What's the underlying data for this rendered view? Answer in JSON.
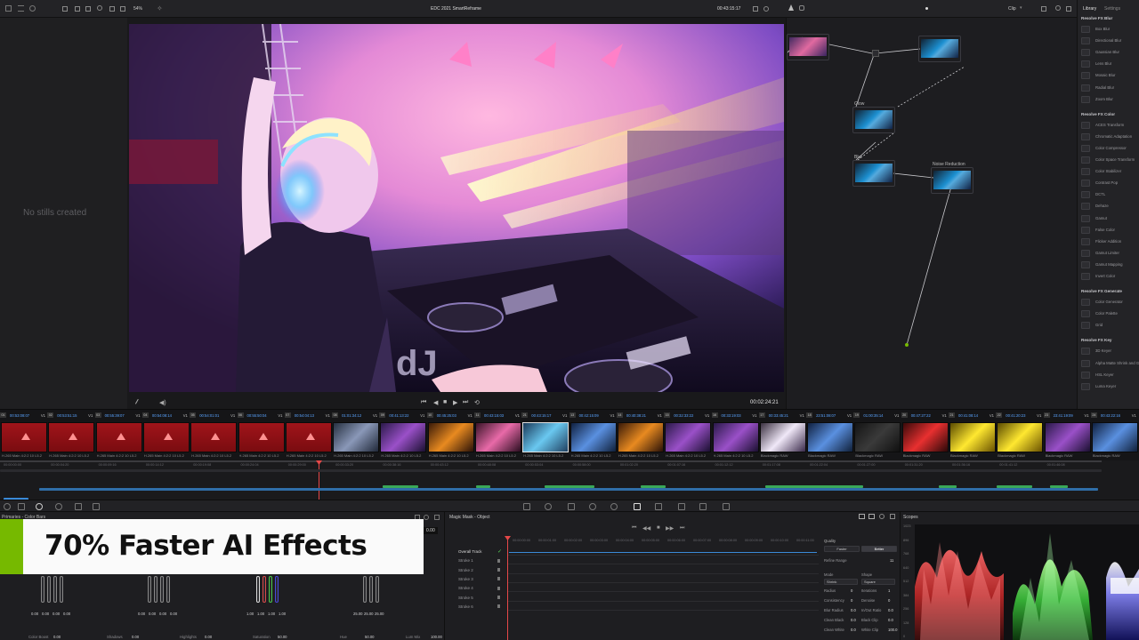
{
  "topbar": {
    "project_title": "EDC 2021 SmartReframe",
    "zoom": "54%",
    "timecode": "00:43:15:17",
    "clip_mode": "Clip",
    "tab_library": "Library",
    "tab_settings": "Settings"
  },
  "gallery": {
    "empty_text": "No stills created"
  },
  "viewer": {
    "timecode": "00:02:24:21"
  },
  "library": {
    "sections": [
      {
        "title": "Resolve FX Blur",
        "items": [
          "Box Blur",
          "Directional Blur",
          "Gaussian Blur",
          "Lens Blur",
          "Mosaic Blur",
          "Radial Blur",
          "Zoom Blur"
        ]
      },
      {
        "title": "Resolve FX Color",
        "items": [
          "ACES Transform",
          "Chromatic Adaptation",
          "Color Compressor",
          "Color Space Transform",
          "Color Stabilizer",
          "Contrast Pop",
          "DCTL",
          "Dehaze",
          "Gamut",
          "False Color",
          "Flicker Addition",
          "Gamut Limiter",
          "Gamut Mapping",
          "Invert Color"
        ]
      },
      {
        "title": "Resolve FX Generate",
        "items": [
          "Color Generator",
          "Color Palette",
          "Grid"
        ]
      },
      {
        "title": "Resolve FX Key",
        "items": [
          "3D Keyer",
          "Alpha Matte Shrink and Grow",
          "HSL Keyer",
          "Luma Keyer"
        ]
      }
    ]
  },
  "nodes": {
    "labels": [
      "Glow",
      "Blur",
      "Noise Reduction"
    ]
  },
  "clips": {
    "items": [
      {
        "num": "01",
        "tc": "00:53:08:07",
        "v": "V1",
        "label": "H.265 Main 4:2:2 10 L5.2",
        "kind": "red"
      },
      {
        "num": "02",
        "tc": "00:53:51:15",
        "v": "V1",
        "label": "H.265 Main 4:2:2 10 L5.2",
        "kind": "red"
      },
      {
        "num": "03",
        "tc": "00:55:39:07",
        "v": "V1",
        "label": "H.265 Main 4:2:2 10 L5.2",
        "kind": "red"
      },
      {
        "num": "04",
        "tc": "00:54:08:14",
        "v": "V1",
        "label": "H.265 Main 4:2:2 10 L5.2",
        "kind": "red"
      },
      {
        "num": "05",
        "tc": "00:54:01:01",
        "v": "V1",
        "label": "H.265 Main 4:2:2 10 L5.2",
        "kind": "red"
      },
      {
        "num": "06",
        "tc": "00:55:50:04",
        "v": "V1",
        "label": "H.265 Main 4:2:2 10 L5.2",
        "kind": "red"
      },
      {
        "num": "07",
        "tc": "00:54:04:13",
        "v": "V1",
        "label": "H.265 Main 4:2:2 10 L5.2",
        "kind": "red"
      },
      {
        "num": "08",
        "tc": "01:01:34:12",
        "v": "V1",
        "label": "H.265 Main 4:2:2 10 L5.2",
        "kind": "crowd"
      },
      {
        "num": "09",
        "tc": "00:41:13:22",
        "v": "V1",
        "label": "H.265 Main 4:2:2 10 L5.2",
        "kind": "purple"
      },
      {
        "num": "10",
        "tc": "00:45:25:03",
        "v": "V1",
        "label": "H.265 Main 4:2:2 10 L5.2",
        "kind": "orange"
      },
      {
        "num": "11",
        "tc": "00:43:15:03",
        "v": "V1",
        "label": "H.265 Main 4:2:2 10 L5.2",
        "kind": "pink"
      },
      {
        "num": "21",
        "tc": "00:43:15:17",
        "v": "V1",
        "label": "H.265 Main 4:2:2 10 L5.2",
        "kind": "active"
      },
      {
        "num": "13",
        "tc": "00:42:15:09",
        "v": "V1",
        "label": "H.265 Main 4:2:2 10 L5.2",
        "kind": "stage"
      },
      {
        "num": "14",
        "tc": "00:40:38:21",
        "v": "V1",
        "label": "H.265 Main 4:2:2 10 L5.2",
        "kind": "orange"
      },
      {
        "num": "15",
        "tc": "00:32:33:22",
        "v": "V1",
        "label": "H.265 Main 4:2:2 10 L5.2",
        "kind": "purple"
      },
      {
        "num": "16",
        "tc": "00:33:19:03",
        "v": "V1",
        "label": "H.265 Main 4:2:2 10 L5.2",
        "kind": "purple"
      },
      {
        "num": "17",
        "tc": "00:33:45:21",
        "v": "V1",
        "label": "Blackmagic RAW",
        "kind": "white"
      },
      {
        "num": "18",
        "tc": "23:51:08:07",
        "v": "V1",
        "label": "Blackmagic RAW",
        "kind": "stage"
      },
      {
        "num": "19",
        "tc": "01:00:35:14",
        "v": "V1",
        "label": "Blackmagic RAW",
        "kind": "dark"
      },
      {
        "num": "20",
        "tc": "00:47:27:22",
        "v": "V1",
        "label": "Blackmagic RAW",
        "kind": "redcrowd"
      },
      {
        "num": "21",
        "tc": "00:41:08:14",
        "v": "V1",
        "label": "Blackmagic RAW",
        "kind": "yellow"
      },
      {
        "num": "22",
        "tc": "00:41:20:23",
        "v": "V1",
        "label": "Blackmagic RAW",
        "kind": "yellow"
      },
      {
        "num": "23",
        "tc": "23:41:19:09",
        "v": "V1",
        "label": "Blackmagic RAW",
        "kind": "purple"
      },
      {
        "num": "24",
        "tc": "00:43:22:16",
        "v": "V1",
        "label": "Blackmagic RAW",
        "kind": "stage"
      }
    ]
  },
  "timeline": {
    "ruler": [
      "00:00:00:00",
      "00:00:04:20",
      "00:00:09:16",
      "00:00:14:12",
      "00:00:19:08",
      "00:00:24:04",
      "00:00:29:00",
      "00:00:33:20",
      "00:00:38:16",
      "00:00:43:12",
      "00:00:48:08",
      "00:00:53:04",
      "00:00:58:00",
      "00:01:02:20",
      "00:01:07:16",
      "00:01:12:12",
      "00:01:17:08",
      "00:01:22:04",
      "00:01:27:00",
      "00:01:31:20",
      "00:01:36:16",
      "00:01:41:12",
      "00:01:46:08"
    ]
  },
  "colorbars": {
    "title": "Primaries - Color Bars",
    "wheels": [
      {
        "values": [
          "0.00",
          "0.00",
          "0.00",
          "0.00"
        ]
      },
      {
        "values": [
          "0.00",
          "0.00",
          "0.00",
          "0.00"
        ]
      },
      {
        "values": [
          "1.00",
          "1.00",
          "1.00",
          "1.00"
        ]
      },
      {
        "values": [
          "25.00",
          "25.00",
          "25.00"
        ]
      }
    ],
    "params": [
      {
        "label": "Color Boost",
        "value": "0.00"
      },
      {
        "label": "Shadows",
        "value": "0.00"
      },
      {
        "label": "Highlights",
        "value": "0.00"
      },
      {
        "label": "Saturation",
        "value": "50.00"
      },
      {
        "label": "Hue",
        "value": "50.00"
      },
      {
        "label": "Lum Mix",
        "value": "100.00"
      }
    ]
  },
  "banner": {
    "text": "70% Faster AI Effects"
  },
  "magicmask": {
    "title": "Magic Mask - Object",
    "value": "0.00",
    "tracks": [
      "Overall Track",
      "Stroke 1",
      "Stroke 2",
      "Stroke 3",
      "Stroke 4",
      "Stroke 5",
      "Stroke 6"
    ],
    "ruler": [
      "00:00:00:00",
      "00:00:01:00",
      "00:00:02:00",
      "00:00:03:00",
      "00:00:04:00",
      "00:00:05:00",
      "00:00:06:00",
      "00:00:07:00",
      "00:00:08:00",
      "00:00:09:00",
      "00:00:10:00",
      "00:00:11:00"
    ]
  },
  "quality": {
    "title": "Quality",
    "faster": "Faster",
    "better": "Better",
    "refine_range": "Refine Range",
    "refine_value": "11",
    "mode": "Mode",
    "mode_value": "Shrink",
    "shape": "Shape",
    "shape_value": "Square",
    "rows": [
      {
        "label": "Radius",
        "value": "0",
        "label2": "Iterations",
        "value2": "1"
      },
      {
        "label": "Consistency",
        "value": "0",
        "label2": "Denoise",
        "value2": "0"
      },
      {
        "label": "Blur Radius",
        "value": "0.0",
        "label2": "In/Out Ratio",
        "value2": "0.0"
      },
      {
        "label": "Clean Black",
        "value": "0.0",
        "label2": "Black Clip",
        "value2": "0.0"
      },
      {
        "label": "Clean White",
        "value": "0.0",
        "label2": "White Clip",
        "value2": "100.0"
      }
    ]
  },
  "scopes": {
    "title": "Scopes",
    "scale": [
      "1023",
      "896",
      "768",
      "640",
      "512",
      "384",
      "256",
      "128",
      "0"
    ]
  },
  "colors": {
    "accent": "#76b900",
    "timecode_blue": "#5aa4ff",
    "playhead": "#e64848"
  }
}
